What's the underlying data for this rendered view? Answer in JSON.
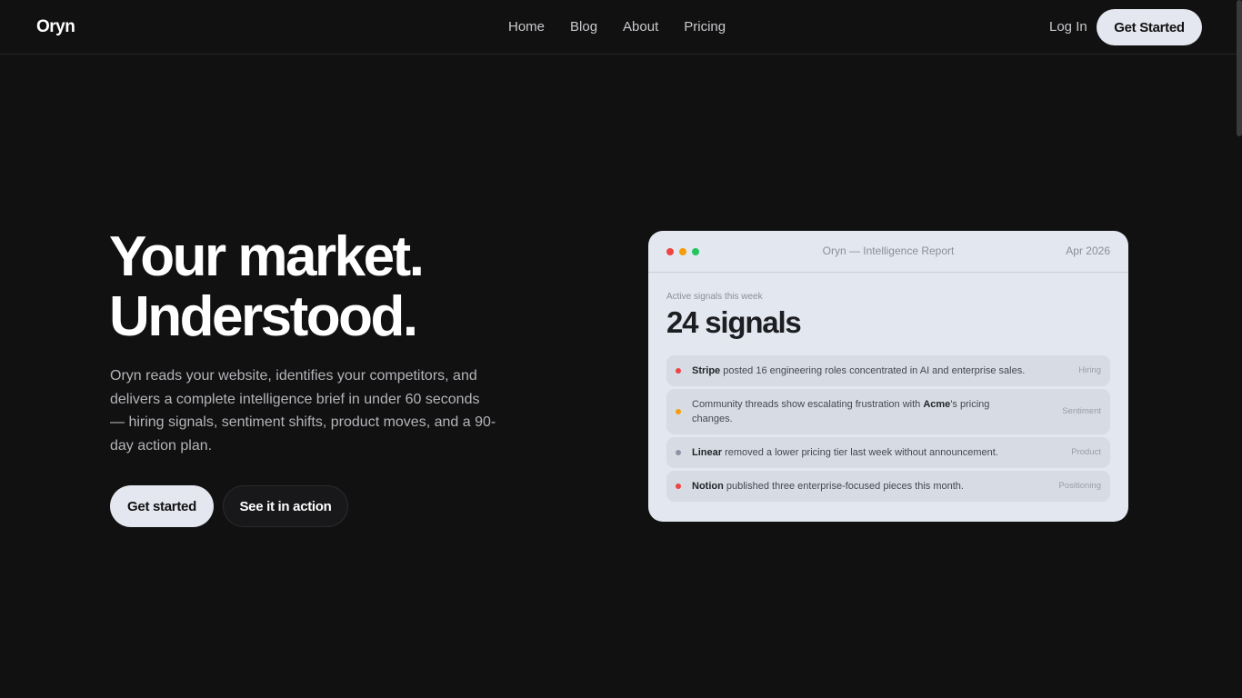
{
  "nav": {
    "logo": "Oryn",
    "links": [
      "Home",
      "Blog",
      "About",
      "Pricing"
    ],
    "login": "Log In",
    "cta": "Get Started"
  },
  "hero": {
    "title_line1": "Your market.",
    "title_line2": "Understood.",
    "description_lines": [
      "Oryn reads your website, identifies your competitors, and",
      "delivers a complete intelligence brief in under 60 seconds",
      "— hiring signals, sentiment shifts, product moves, and a 90-",
      "day action plan."
    ],
    "primary_button": "Get started",
    "secondary_button": "See it in action"
  },
  "report": {
    "window_dots": [
      "#ef4444",
      "#f59e0b",
      "#22c55e"
    ],
    "title": "Oryn — Intelligence Report",
    "date": "Apr 2026",
    "subtitle": "Active signals this week",
    "count": "24 signals",
    "signals": [
      {
        "dot_color": "#ef4444",
        "company": "Stripe",
        "text_before": "",
        "text_after": " posted 16 engineering roles concentrated in AI and enterprise sales.",
        "line2": "",
        "tag": "Hiring"
      },
      {
        "dot_color": "#f59e0b",
        "company": "Acme",
        "text_before": "Community threads show escalating frustration with ",
        "text_after": "'s pricing",
        "line2": "changes.",
        "tag": "Sentiment"
      },
      {
        "dot_color": "#8b93a5",
        "company": "Linear",
        "text_before": "",
        "text_after": " removed a lower pricing tier last week without announcement.",
        "line2": "",
        "tag": "Product"
      },
      {
        "dot_color": "#ef4444",
        "company": "Notion",
        "text_before": "",
        "text_after": " published three enterprise-focused pieces this month.",
        "line2": "",
        "tag": "Positioning"
      }
    ]
  },
  "colors": {
    "background": "#111112",
    "card": "#e3e7ef",
    "button_light": "#e4e7ef"
  }
}
